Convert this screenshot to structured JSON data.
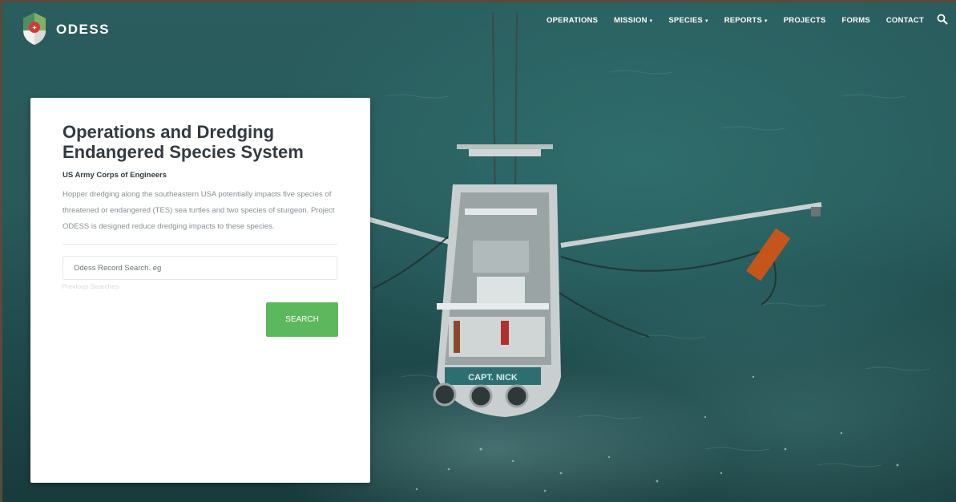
{
  "brand": {
    "name": "ODESS"
  },
  "nav": {
    "items": [
      {
        "label": "OPERATIONS",
        "has_dropdown": false
      },
      {
        "label": "MISSION",
        "has_dropdown": true
      },
      {
        "label": "SPECIES",
        "has_dropdown": true
      },
      {
        "label": "REPORTS",
        "has_dropdown": true
      },
      {
        "label": "PROJECTS",
        "has_dropdown": false
      },
      {
        "label": "FORMS",
        "has_dropdown": false
      },
      {
        "label": "CONTACT",
        "has_dropdown": false
      }
    ],
    "caret_glyph": "▾",
    "search_icon": "search-icon"
  },
  "hero": {
    "background": "aerial photo of a shrimp trawler boat on green sea water",
    "boat_name": "CAPT. NICK"
  },
  "card": {
    "title": "Operations and Dredging Endangered Species System",
    "subtitle": "US Army Corps of Engineers",
    "description": "Hopper dredging along the southeastern USA potentially impacts five species of threatened or endangered (TES) sea turtles and two species of sturgeon. Project ODESS is designed reduce dredging impacts to these species.",
    "search": {
      "placeholder": "Odess Record Search. eg",
      "value": ""
    },
    "previous_searches_label": "Previous Searches",
    "search_button_label": "SEARCH"
  },
  "colors": {
    "primary_button": "#5cb85c",
    "card_background": "#ffffff",
    "title_text": "#333a40",
    "body_text": "#8a8f94",
    "water": "#2a5d5e"
  }
}
